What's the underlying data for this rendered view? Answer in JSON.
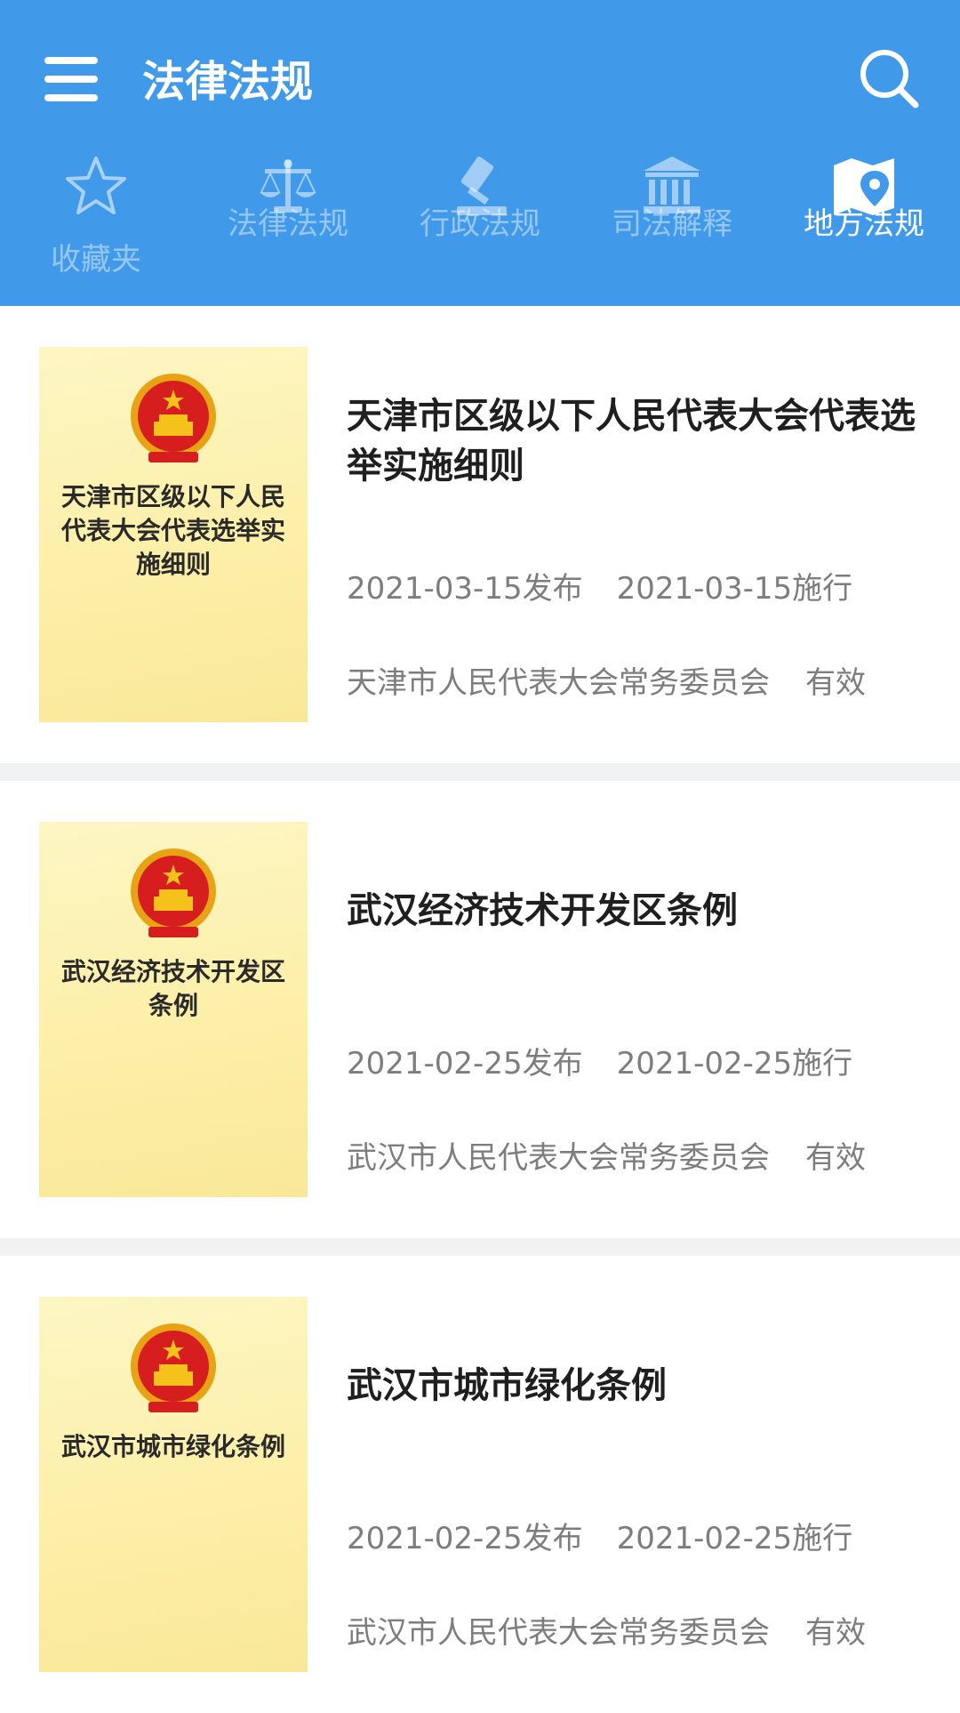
{
  "header": {
    "title": "法律法规",
    "bg_color": "#4199ea"
  },
  "tabs": [
    {
      "label": "收藏夹",
      "icon": "star-icon",
      "active": false
    },
    {
      "label": "法律法规",
      "icon": "scales-icon",
      "active": false
    },
    {
      "label": "行政法规",
      "icon": "gavel-icon",
      "active": false
    },
    {
      "label": "司法解释",
      "icon": "courthouse-icon",
      "active": false
    },
    {
      "label": "地方法规",
      "icon": "map-pin-icon",
      "active": true
    }
  ],
  "items": [
    {
      "cover_title": "天津市区级以下人民代表大会代表选举实施细则",
      "title": "天津市区级以下人民代表大会代表选举实施细则",
      "publish": "2021-03-15发布",
      "effective": "2021-03-15施行",
      "authority": "天津市人民代表大会常务委员会",
      "status": "有效"
    },
    {
      "cover_title": "武汉经济技术开发区条例",
      "title": "武汉经济技术开发区条例",
      "publish": "2021-02-25发布",
      "effective": "2021-02-25施行",
      "authority": "武汉市人民代表大会常务委员会",
      "status": "有效"
    },
    {
      "cover_title": "武汉市城市绿化条例",
      "title": "武汉市城市绿化条例",
      "publish": "2021-02-25发布",
      "effective": "2021-02-25施行",
      "authority": "武汉市人民代表大会常务委员会",
      "status": "有效"
    }
  ]
}
